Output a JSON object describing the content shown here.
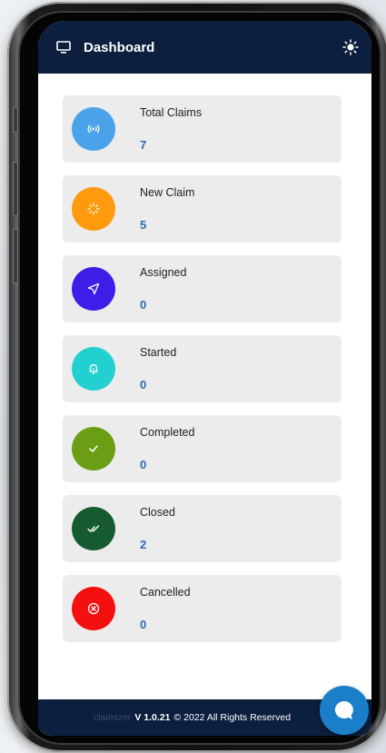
{
  "header": {
    "title": "Dashboard",
    "menu_icon": "monitor-icon",
    "theme_icon": "sun-icon"
  },
  "cards": [
    {
      "label": "Total Claims",
      "count": "7",
      "icon": "broadcast-icon",
      "color": "#4aa3ea"
    },
    {
      "label": "New Claim",
      "count": "5",
      "icon": "loader-icon",
      "color": "#ff9a0e"
    },
    {
      "label": "Assigned",
      "count": "0",
      "icon": "send-icon",
      "color": "#3d1ee8"
    },
    {
      "label": "Started",
      "count": "0",
      "icon": "bell-icon",
      "color": "#22d1cf"
    },
    {
      "label": "Completed",
      "count": "0",
      "icon": "check-icon",
      "color": "#6b9e14"
    },
    {
      "label": "Closed",
      "count": "2",
      "icon": "double-check-icon",
      "color": "#165a30"
    },
    {
      "label": "Cancelled",
      "count": "0",
      "icon": "x-circle-icon",
      "color": "#f51010"
    }
  ],
  "footer": {
    "brand": "claimizer",
    "version": "V 1.0.21",
    "copyright": "© 2022 All Rights Reserved"
  },
  "chat": {
    "icon": "chat-bubble-icon",
    "color": "#1a7fc8"
  }
}
